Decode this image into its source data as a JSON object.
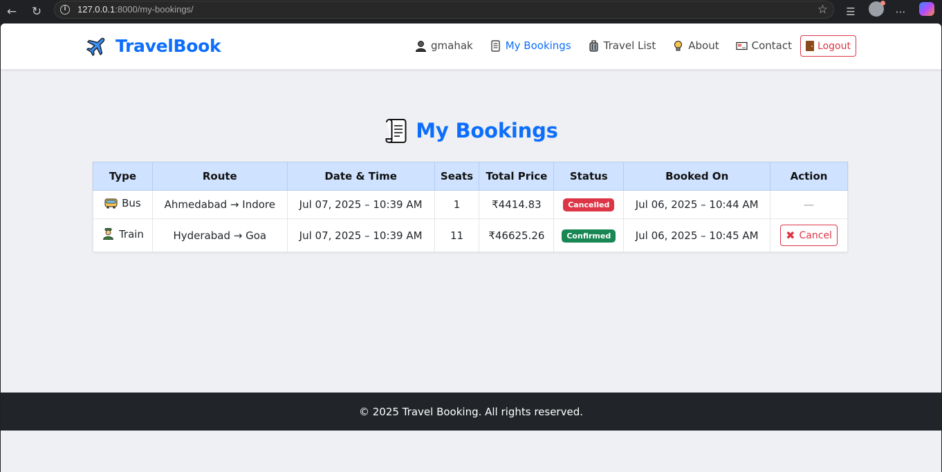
{
  "browser": {
    "url_host": "127.0.0.1",
    "url_rest": ":8000/my-bookings/"
  },
  "navbar": {
    "brand": "TravelBook",
    "links": [
      {
        "label": "gmahak",
        "icon": "user-icon"
      },
      {
        "label": "My Bookings",
        "icon": "receipt-icon",
        "active": true
      },
      {
        "label": "Travel List",
        "icon": "luggage-icon"
      },
      {
        "label": "About",
        "icon": "lightbulb-icon"
      },
      {
        "label": "Contact",
        "icon": "envelope-icon"
      }
    ],
    "logout": "Logout"
  },
  "page": {
    "title": "My Bookings"
  },
  "table": {
    "headers": [
      "Type",
      "Route",
      "Date & Time",
      "Seats",
      "Total Price",
      "Status",
      "Booked On",
      "Action"
    ],
    "rows": [
      {
        "type": "Bus",
        "type_icon": "bus-icon",
        "route": "Ahmedabad → Indore",
        "datetime": "Jul 07, 2025 – 10:39 AM",
        "seats": "1",
        "price": "₹4414.83",
        "status": "Cancelled",
        "booked_on": "Jul 06, 2025 – 10:44 AM",
        "action": "—"
      },
      {
        "type": "Train",
        "type_icon": "train-conductor-icon",
        "route": "Hyderabad → Goa",
        "datetime": "Jul 07, 2025 – 10:39 AM",
        "seats": "11",
        "price": "₹46625.26",
        "status": "Confirmed",
        "booked_on": "Jul 06, 2025 – 10:45 AM",
        "action": "Cancel"
      }
    ]
  },
  "footer": {
    "text": "© 2025 Travel Booking. All rights reserved."
  },
  "colors": {
    "primary": "#0d6efd",
    "danger": "#dc3545",
    "success": "#198754",
    "header_bg": "#cfe2ff",
    "footer_bg": "#212529"
  }
}
